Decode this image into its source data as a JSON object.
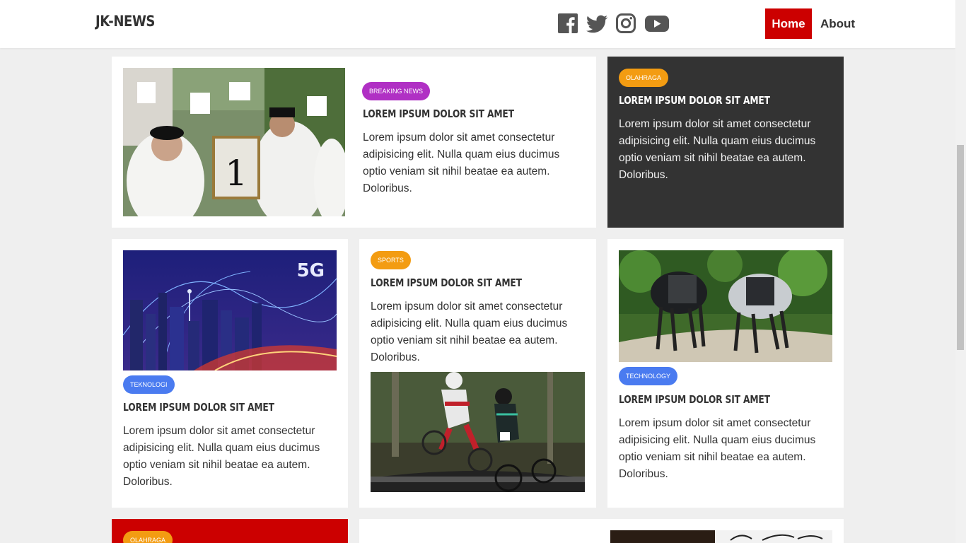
{
  "header": {
    "logo": "JK-NEWS",
    "social": [
      "facebook-icon",
      "twitter-icon",
      "instagram-icon",
      "youtube-icon"
    ],
    "nav": {
      "home": "Home",
      "about": "About"
    }
  },
  "colors": {
    "accent": "#cc0000",
    "dark_card": "#333333",
    "badge_breaking": "#b030c4",
    "badge_sports": "#f39c12",
    "badge_tech": "#4a7bf0"
  },
  "articles": [
    {
      "badge": "BREAKING NEWS",
      "title": "LOREM IPSUM DOLOR SIT AMET",
      "text": "Lorem ipsum dolor sit amet consectetur adipisicing elit. Nulla quam eius ducimus optio veniam sit nihil beatae ea autem. Doloribus.",
      "image": "election-crowd-photo"
    },
    {
      "badge": "OLAHRAGA",
      "title": "LOREM IPSUM DOLOR SIT AMET",
      "text": "Lorem ipsum dolor sit amet consectetur adipisicing elit. Nulla quam eius ducimus optio veniam sit nihil beatae ea autem. Doloribus."
    },
    {
      "badge": "TEKNOLOGI",
      "title": "LOREM IPSUM DOLOR SIT AMET",
      "text": "Lorem ipsum dolor sit amet consectetur adipisicing elit. Nulla quam eius ducimus optio veniam sit nihil beatae ea autem. Doloribus.",
      "image": "5g-city-photo",
      "image_text": "5G"
    },
    {
      "badge": "SPORTS",
      "title": "LOREM IPSUM DOLOR SIT AMET",
      "text": "Lorem ipsum dolor sit amet consectetur adipisicing elit. Nulla quam eius ducimus optio veniam sit nihil beatae ea autem. Doloribus.",
      "image": "bmx-race-photo"
    },
    {
      "badge": "TECHNOLOGY",
      "title": "LOREM IPSUM DOLOR SIT AMET",
      "text": "Lorem ipsum dolor sit amet consectetur adipisicing elit. Nulla quam eius ducimus optio veniam sit nihil beatae ea autem. Doloribus.",
      "image": "robot-dogs-photo"
    },
    {
      "badge": "OLAHRAGA"
    }
  ]
}
